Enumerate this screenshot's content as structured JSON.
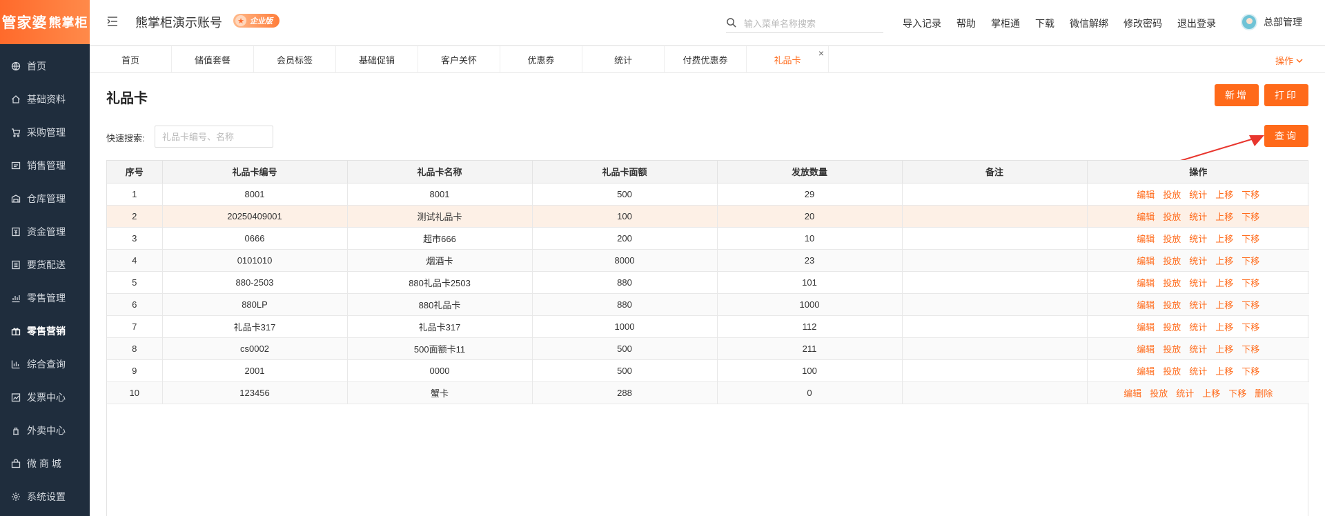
{
  "logo": {
    "part1": "管家婆",
    "part2": "熊掌柜"
  },
  "sidebar": {
    "items": [
      {
        "label": "首页",
        "icon": "globe-icon",
        "active": false
      },
      {
        "label": "基础资料",
        "icon": "home-icon",
        "active": false
      },
      {
        "label": "采购管理",
        "icon": "cart-icon",
        "active": false
      },
      {
        "label": "销售管理",
        "icon": "sales-icon",
        "active": false
      },
      {
        "label": "仓库管理",
        "icon": "warehouse-icon",
        "active": false
      },
      {
        "label": "资金管理",
        "icon": "money-icon",
        "active": false
      },
      {
        "label": "要货配送",
        "icon": "list-icon",
        "active": false
      },
      {
        "label": "零售管理",
        "icon": "chart-icon",
        "active": false
      },
      {
        "label": "零售营销",
        "icon": "gift-icon",
        "active": true
      },
      {
        "label": "综合查询",
        "icon": "bar-chart-icon",
        "active": false
      },
      {
        "label": "发票中心",
        "icon": "trend-icon",
        "active": false
      },
      {
        "label": "外卖中心",
        "icon": "delivery-icon",
        "active": false
      },
      {
        "label": "微 商 城",
        "icon": "shop-icon",
        "active": false
      },
      {
        "label": "系统设置",
        "icon": "gear-icon",
        "active": false
      }
    ]
  },
  "header": {
    "account_title": "熊掌柜演示账号",
    "badge": "企业版",
    "search_placeholder": "输入菜单名称搜索",
    "links": [
      "导入记录",
      "帮助",
      "掌柜通",
      "下载",
      "微信解绑",
      "修改密码",
      "退出登录"
    ],
    "user_name": "总部管理"
  },
  "tabs": {
    "items": [
      "首页",
      "储值套餐",
      "会员标签",
      "基础促销",
      "客户关怀",
      "优惠券",
      "统计",
      "付费优惠券",
      "礼品卡"
    ],
    "active_index": 8,
    "close_glyph": "×",
    "operations_label": "操作"
  },
  "page": {
    "title": "礼品卡",
    "add_label": "新增",
    "print_label": "打印",
    "query_label": "查询",
    "quick_search_label": "快速搜索:",
    "quick_search_placeholder": "礼品卡编号、名称"
  },
  "table": {
    "columns": [
      "序号",
      "礼品卡编号",
      "礼品卡名称",
      "礼品卡面额",
      "发放数量",
      "备注",
      "操作"
    ],
    "rows": [
      {
        "no": "1",
        "code": "8001",
        "name": "8001",
        "face": "500",
        "qty": "29",
        "note": "",
        "ops": [
          "编辑",
          "投放",
          "统计",
          "上移",
          "下移"
        ]
      },
      {
        "no": "2",
        "code": "20250409001",
        "name": "测试礼品卡",
        "face": "100",
        "qty": "20",
        "note": "",
        "ops": [
          "编辑",
          "投放",
          "统计",
          "上移",
          "下移"
        ]
      },
      {
        "no": "3",
        "code": "0666",
        "name": "超市666",
        "face": "200",
        "qty": "10",
        "note": "",
        "ops": [
          "编辑",
          "投放",
          "统计",
          "上移",
          "下移"
        ]
      },
      {
        "no": "4",
        "code": "0101010",
        "name": "烟酒卡",
        "face": "8000",
        "qty": "23",
        "note": "",
        "ops": [
          "编辑",
          "投放",
          "统计",
          "上移",
          "下移"
        ]
      },
      {
        "no": "5",
        "code": "880-2503",
        "name": "880礼品卡2503",
        "face": "880",
        "qty": "101",
        "note": "",
        "ops": [
          "编辑",
          "投放",
          "统计",
          "上移",
          "下移"
        ]
      },
      {
        "no": "6",
        "code": "880LP",
        "name": "880礼品卡",
        "face": "880",
        "qty": "1000",
        "note": "",
        "ops": [
          "编辑",
          "投放",
          "统计",
          "上移",
          "下移"
        ]
      },
      {
        "no": "7",
        "code": "礼品卡317",
        "name": "礼品卡317",
        "face": "1000",
        "qty": "112",
        "note": "",
        "ops": [
          "编辑",
          "投放",
          "统计",
          "上移",
          "下移"
        ]
      },
      {
        "no": "8",
        "code": "cs0002",
        "name": "500面额卡11",
        "face": "500",
        "qty": "211",
        "note": "",
        "ops": [
          "编辑",
          "投放",
          "统计",
          "上移",
          "下移"
        ]
      },
      {
        "no": "9",
        "code": "2001",
        "name": "0000",
        "face": "500",
        "qty": "100",
        "note": "",
        "ops": [
          "编辑",
          "投放",
          "统计",
          "上移",
          "下移"
        ]
      },
      {
        "no": "10",
        "code": "123456",
        "name": "蟹卡",
        "face": "288",
        "qty": "0",
        "note": "",
        "ops": [
          "编辑",
          "投放",
          "统计",
          "上移",
          "下移",
          "删除"
        ]
      }
    ],
    "highlight_row": 1
  },
  "colors": {
    "accent": "#ff6a1a",
    "sidebar_bg": "#1f2d3d",
    "highlight_row": "#fdf0e6",
    "annotation_arrow": "#e8362e"
  }
}
